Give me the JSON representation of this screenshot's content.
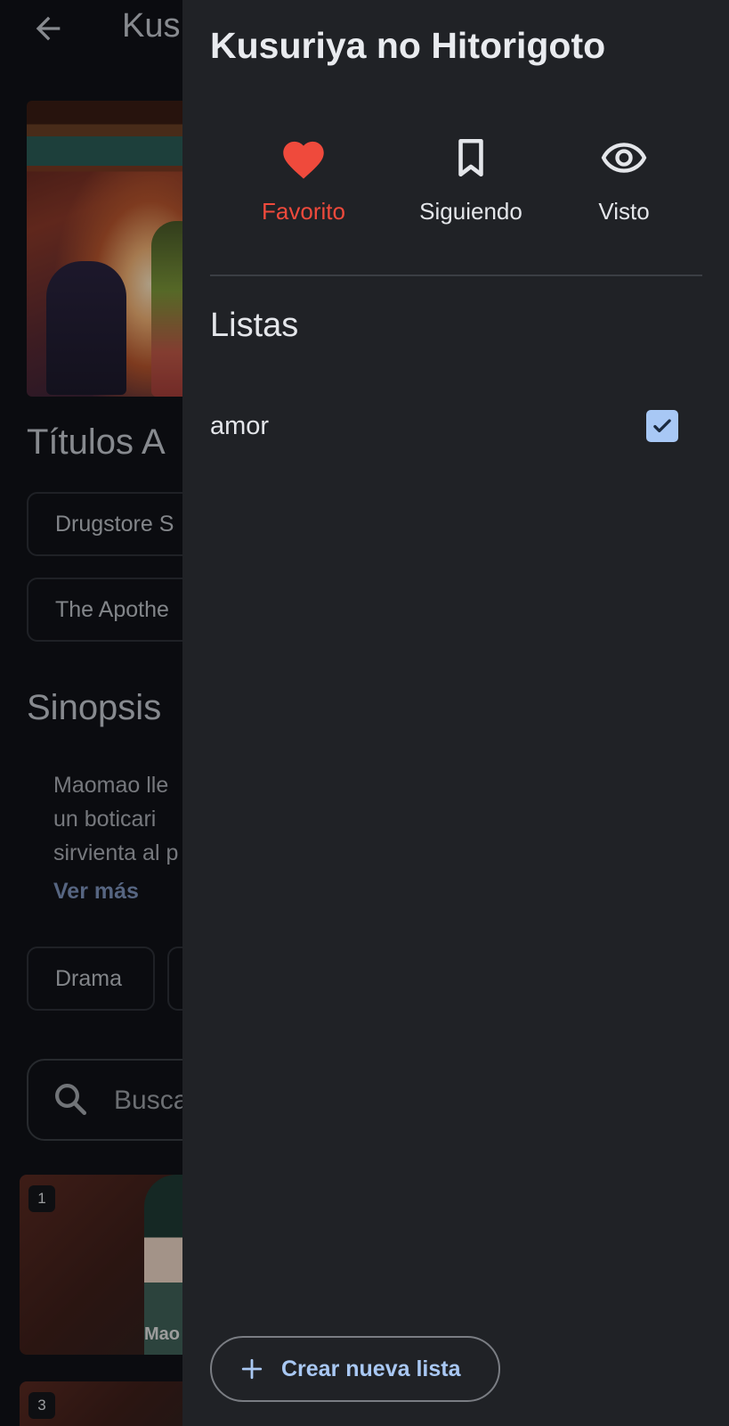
{
  "background": {
    "app_title": "Kus",
    "section_titles_alt": "Títulos A",
    "alt_titles": [
      "Drugstore S",
      "The Apothe"
    ],
    "section_synopsis": "Sinopsis",
    "synopsis_lines": [
      "Maomao lle",
      "un  boticari",
      "sirvienta al p"
    ],
    "see_more": "Ver más",
    "genre_chip": "Drama",
    "search_placeholder": "Busca",
    "episodes": [
      {
        "number": "1",
        "caption": "Mao"
      },
      {
        "number": "3",
        "caption": ""
      }
    ]
  },
  "drawer": {
    "title": "Kusuriya no Hitorigoto",
    "actions": [
      {
        "label": "Favorito",
        "icon": "heart-icon",
        "active": true,
        "color": "#ef4a3c"
      },
      {
        "label": "Siguiendo",
        "icon": "bookmark-icon",
        "active": false
      },
      {
        "label": "Visto",
        "icon": "eye-icon",
        "active": false
      }
    ],
    "lists_heading": "Listas",
    "lists": [
      {
        "name": "amor",
        "checked": true
      }
    ],
    "create_button": {
      "label": "Crear nueva lista",
      "icon": "plus-icon"
    }
  },
  "colors": {
    "accent_blue": "#a9c8f3",
    "favorite_red": "#ef4a3c",
    "drawer_bg": "#202226"
  }
}
